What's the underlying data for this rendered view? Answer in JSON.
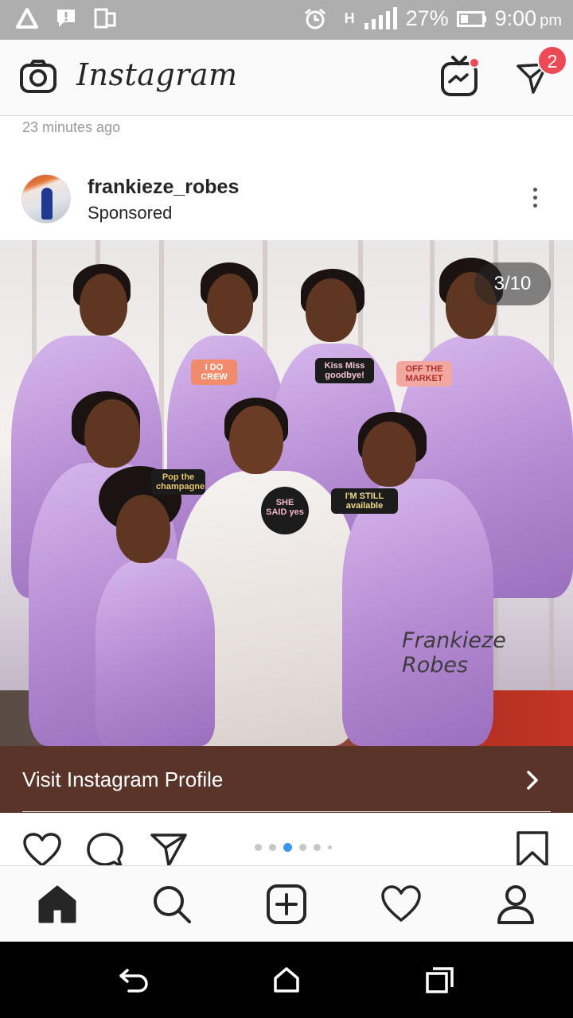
{
  "status_bar": {
    "network_type": "H",
    "battery_percent": "27%",
    "time": "9:00",
    "time_suffix": "pm"
  },
  "header": {
    "logo_text": "Instagram",
    "dm_badge_count": "2"
  },
  "feed": {
    "previous_post_time": "23 minutes ago"
  },
  "post": {
    "username": "frankieze_robes",
    "sponsored_label": "Sponsored",
    "image_counter": "3/10",
    "watermark": "Frankieze Robes",
    "props": {
      "sign_i_do": "I DO CREW",
      "sign_kiss": "Kiss Miss goodbye!",
      "sign_market": "OFF THE MARKET",
      "sign_champagne": "Pop the champagne",
      "sign_she_said": "SHE SAID yes",
      "sign_available": "I'M STILL available"
    },
    "cta_label": "Visit Instagram Profile",
    "carousel_dots": {
      "total": 6,
      "active_index": 2
    }
  },
  "colors": {
    "accent_blue": "#3897f0",
    "badge_red": "#ed4956",
    "cta_background": "#5a3429",
    "robe_lilac": "#c3a0e0"
  },
  "icons": {
    "header": [
      "camera-icon",
      "igtv-icon",
      "direct-message-icon"
    ],
    "actions": [
      "heart-icon",
      "comment-icon",
      "share-icon",
      "bookmark-icon"
    ],
    "bottom_nav": [
      "home-icon",
      "search-icon",
      "add-post-icon",
      "activity-heart-icon",
      "profile-icon"
    ],
    "system_nav": [
      "back-icon",
      "home-system-icon",
      "recents-icon"
    ]
  }
}
